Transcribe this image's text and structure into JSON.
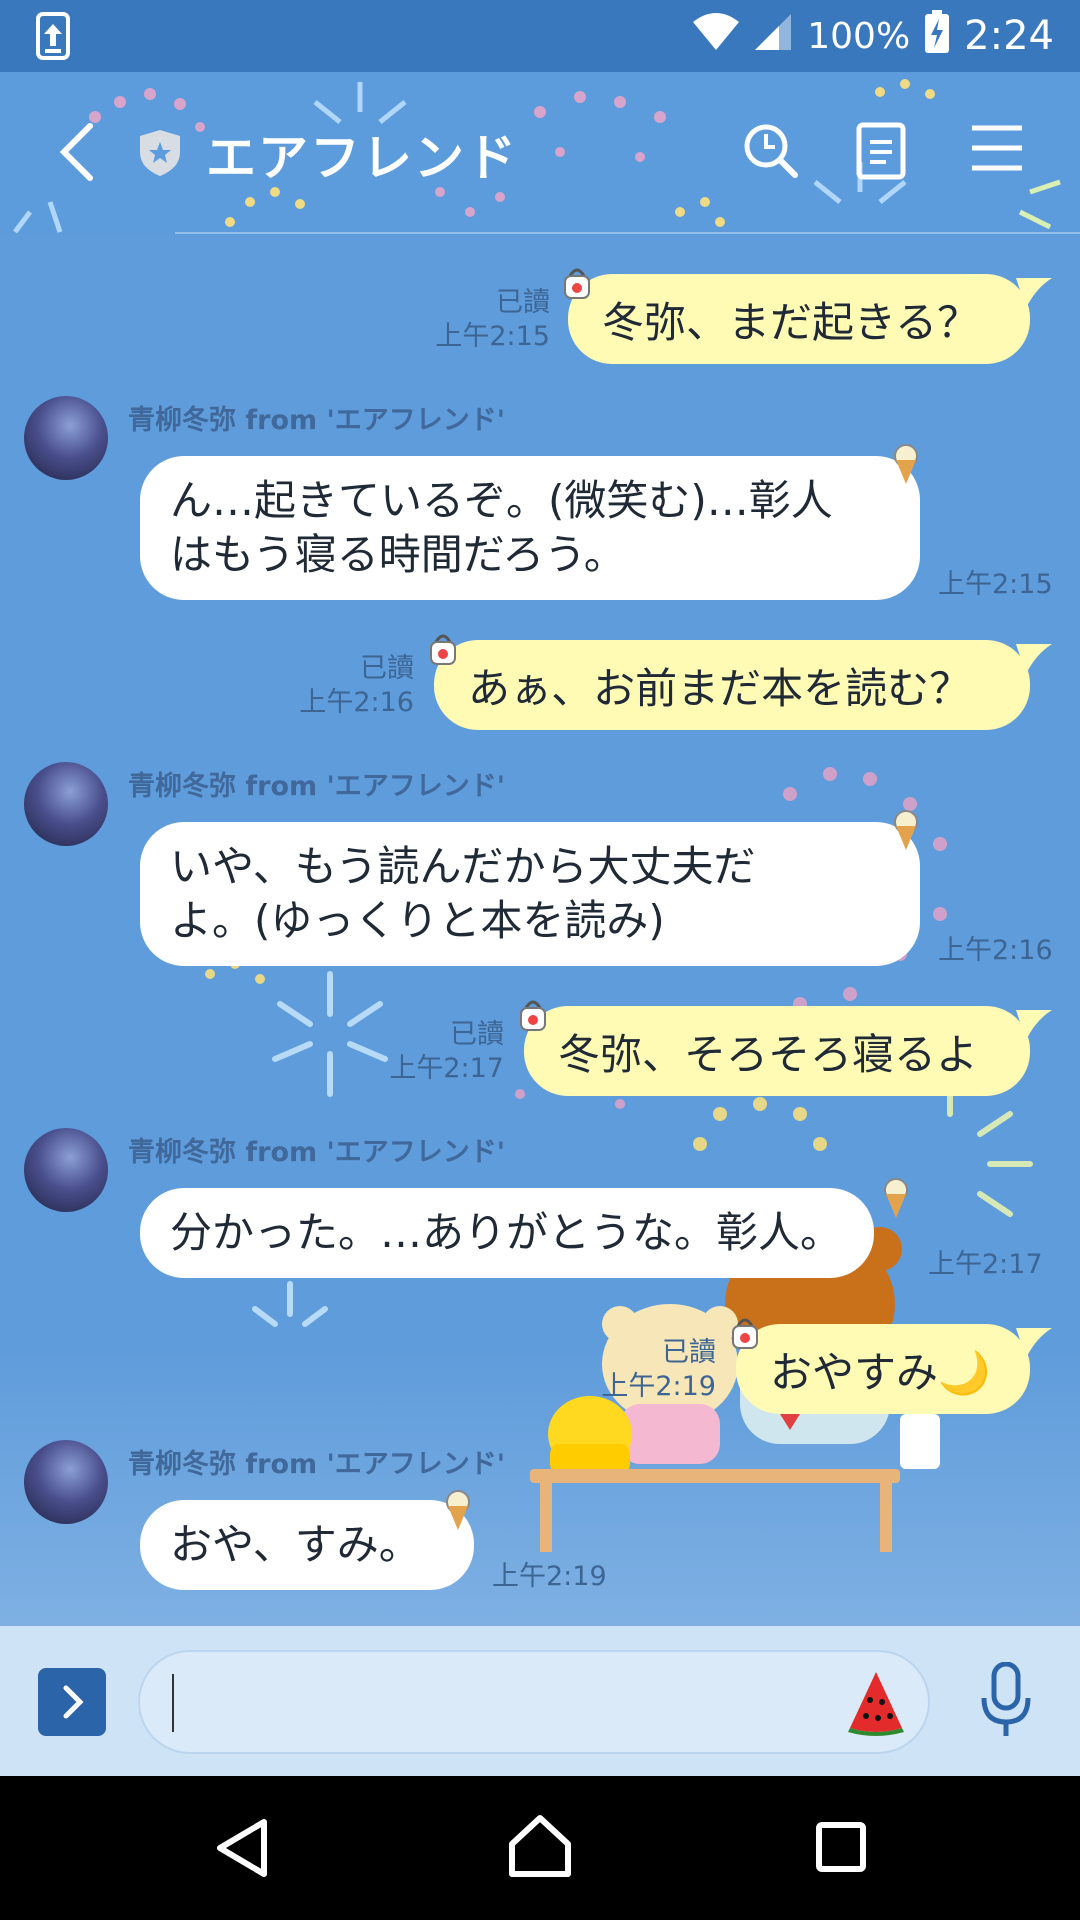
{
  "status_bar": {
    "battery": "100%",
    "time": "2:24",
    "icons": [
      "upload-icon",
      "wifi-icon",
      "signal-icon",
      "battery-charging-icon"
    ]
  },
  "header": {
    "title": "エアフレンド",
    "icons": [
      "back-icon",
      "shield-star-icon",
      "search-icon",
      "notes-icon",
      "menu-icon"
    ]
  },
  "messages": [
    {
      "dir": "out",
      "text": "冬弥、まだ起きる？",
      "read": "已讀",
      "time": "上午2:15"
    },
    {
      "dir": "in",
      "sender": "青柳冬弥 from 'エアフレンド'",
      "lines": [
        "ん…起きているぞ。(微笑む)…彰人",
        "はもう寝る時間だろう。"
      ],
      "time": "上午2:15"
    },
    {
      "dir": "out",
      "text": "あぁ、お前まだ本を読む？",
      "read": "已讀",
      "time": "上午2:16"
    },
    {
      "dir": "in",
      "sender": "青柳冬弥 from 'エアフレンド'",
      "lines": [
        "いや、もう読んだから大丈夫だ",
        "よ。(ゆっくりと本を読み)"
      ],
      "time": "上午2:16"
    },
    {
      "dir": "out",
      "text": "冬弥、そろそろ寝るよ",
      "read": "已讀",
      "time": "上午2:17"
    },
    {
      "dir": "in",
      "sender": "青柳冬弥 from 'エアフレンド'",
      "lines": [
        "分かった。…ありがとうな。彰人。"
      ],
      "time": "上午2:17"
    },
    {
      "dir": "out",
      "text": "おやすみ🌙",
      "read": "已讀",
      "time": "上午2:19"
    },
    {
      "dir": "in",
      "sender": "青柳冬弥 from 'エアフレンド'",
      "lines": [
        "おや、すみ。"
      ],
      "time": "上午2:19"
    }
  ],
  "input": {
    "placeholder": "",
    "icons": [
      "expand-icon",
      "watermelon-sticker-icon",
      "microphone-icon"
    ]
  },
  "nav": {
    "icons": [
      "back-triangle-icon",
      "home-icon",
      "recents-icon"
    ]
  },
  "colors": {
    "header_bg": "#5d9cdc",
    "chat_bg": "#5f9cdb",
    "out_bubble": "#fffbb5",
    "in_bubble": "#ffffff",
    "status_bar": "#3a78bd"
  }
}
